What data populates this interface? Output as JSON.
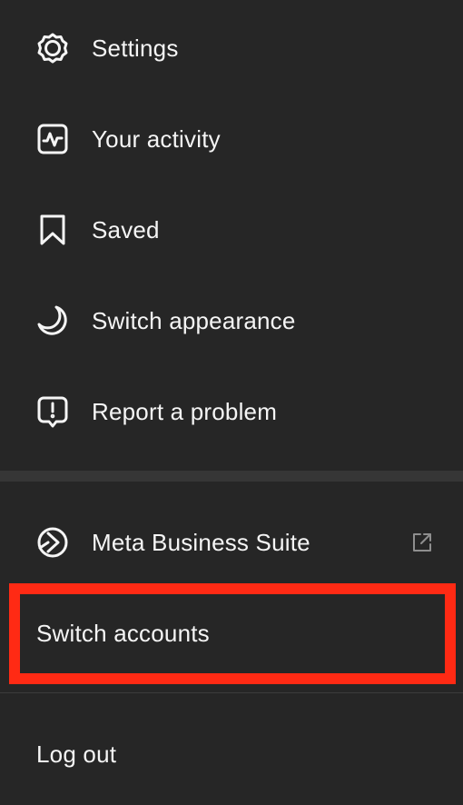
{
  "menu": {
    "items": [
      {
        "label": "Settings",
        "icon": "gear-icon"
      },
      {
        "label": "Your activity",
        "icon": "activity-icon"
      },
      {
        "label": "Saved",
        "icon": "bookmark-icon"
      },
      {
        "label": "Switch appearance",
        "icon": "moon-icon"
      },
      {
        "label": "Report a problem",
        "icon": "report-icon"
      }
    ],
    "business": {
      "label": "Meta Business Suite",
      "icon": "meta-business-icon",
      "external_icon": "external-link-icon"
    },
    "switch_accounts": {
      "label": "Switch accounts"
    },
    "log_out": {
      "label": "Log out"
    }
  },
  "colors": {
    "background": "#262626",
    "text": "#f5f5f5",
    "highlight": "#ff2a14"
  }
}
